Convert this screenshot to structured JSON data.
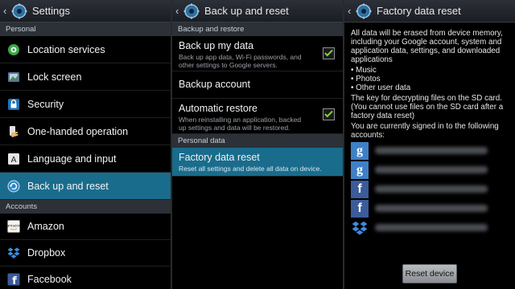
{
  "settings_panel": {
    "title": "Settings",
    "sections": {
      "personal": "Personal",
      "accounts": "Accounts"
    },
    "items": [
      {
        "label": "Location services",
        "icon": "location-icon"
      },
      {
        "label": "Lock screen",
        "icon": "lock-screen-icon"
      },
      {
        "label": "Security",
        "icon": "security-lock-icon"
      },
      {
        "label": "One-handed operation",
        "icon": "hand-icon"
      },
      {
        "label": "Language and input",
        "icon": "language-icon"
      },
      {
        "label": "Back up and reset",
        "icon": "backup-reset-icon",
        "selected": true
      }
    ],
    "accounts": [
      {
        "label": "Amazon",
        "icon": "amazon-icon"
      },
      {
        "label": "Dropbox",
        "icon": "dropbox-icon"
      },
      {
        "label": "Facebook",
        "icon": "facebook-icon"
      }
    ]
  },
  "backup_panel": {
    "title": "Back up and reset",
    "sections": {
      "backup_restore": "Backup and restore",
      "personal_data": "Personal data"
    },
    "backup_my_data": {
      "title": "Back up my data",
      "subtitle": "Back up app data, Wi-Fi passwords, and other settings to Google servers.",
      "checked": true
    },
    "backup_account": {
      "title": "Backup account"
    },
    "automatic_restore": {
      "title": "Automatic restore",
      "subtitle": "When reinstalling an application, backed up settings and data will be restored.",
      "checked": true
    },
    "factory_reset": {
      "title": "Factory data reset",
      "subtitle": "Reset all settings and delete all data on device."
    }
  },
  "factory_panel": {
    "title": "Factory data reset",
    "intro": "All data will be erased from device memory, including your Google account, system and application data, settings, and downloaded applications",
    "bullets": [
      "Music",
      "Photos",
      "Other user data"
    ],
    "key_note": "The key for decrypting files on the SD card. (You cannot use files on the SD card after a factory data reset)",
    "signed_in": "You are currently signed in to the following accounts:",
    "accounts": [
      {
        "type": "google",
        "icon": "google-icon",
        "glyph": "g"
      },
      {
        "type": "google",
        "icon": "google-icon",
        "glyph": "g"
      },
      {
        "type": "facebook",
        "icon": "facebook-icon",
        "glyph": "f"
      },
      {
        "type": "facebook",
        "icon": "facebook-icon",
        "glyph": "f"
      },
      {
        "type": "dropbox",
        "icon": "dropbox-icon",
        "glyph": ""
      }
    ],
    "reset_button": "Reset device"
  },
  "colors": {
    "selected": "#1a6c8c",
    "section_header": "#2b3137",
    "check": "#7dd43b"
  }
}
